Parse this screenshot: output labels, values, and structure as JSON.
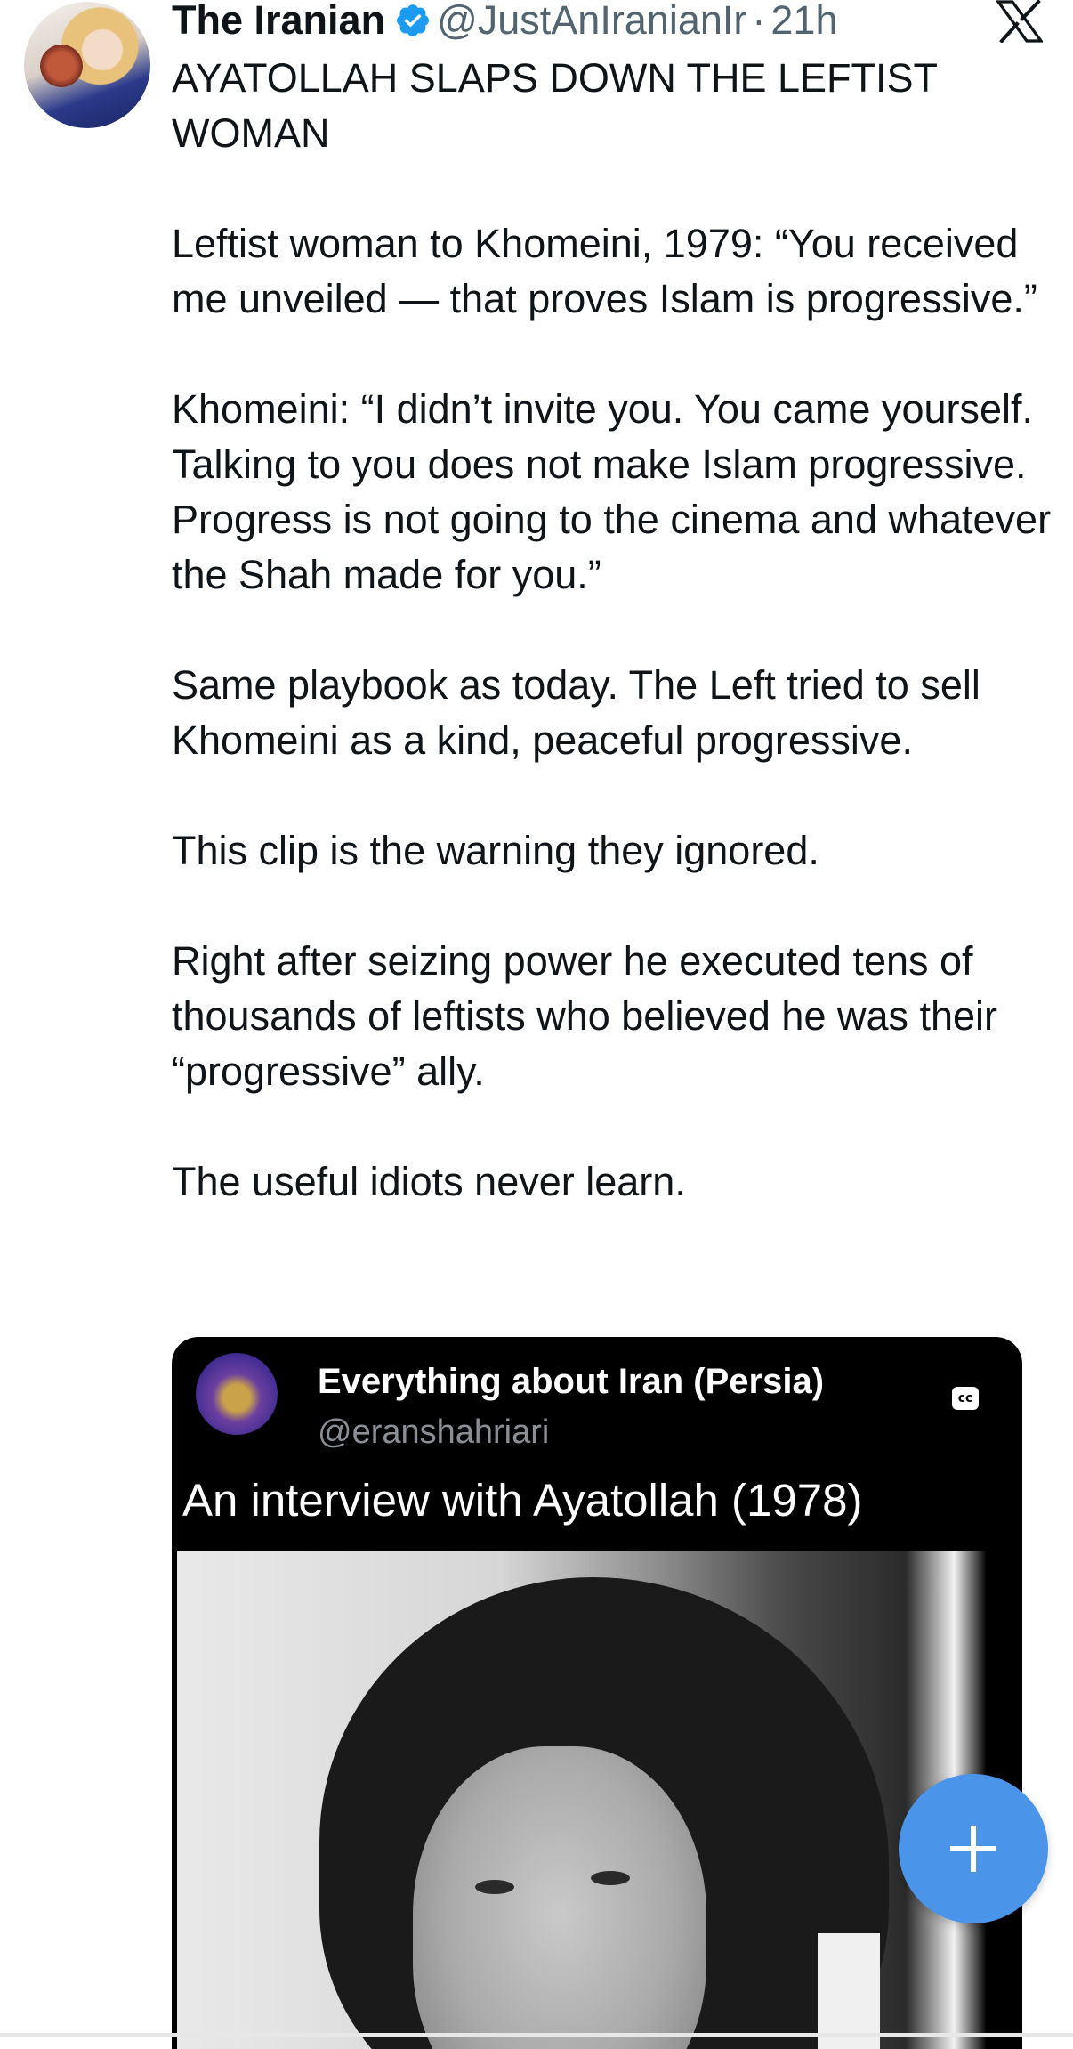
{
  "author": {
    "display_name": "The Iranian",
    "handle": "@JustAnIranianIr",
    "separator": "·",
    "time_ago": "21h",
    "verified": true,
    "verified_color": "#1d9bf0"
  },
  "tweet": {
    "paragraphs": [
      "AYATOLLAH SLAPS DOWN THE LEFTIST WOMAN",
      "Leftist woman to Khomeini, 1979: “You received me unveiled — that proves Islam is progressive.”",
      "Khomeini: “I didn’t invite you. You came yourself. Talking to you does not make Islam progressive. Progress is not going to the cinema and whatever the Shah made for you.”",
      "Same playbook as today. The Left tried to sell Khomeini as a kind, peaceful progressive.",
      "This clip is the warning they ignored.",
      "Right after seizing power he executed tens of thousands of leftists who believed he was their “progressive” ally.",
      "The useful idiots never learn."
    ]
  },
  "media": {
    "source_name": "Everything about Iran (Persia)",
    "source_handle": "@eranshahriari",
    "cc_label": "cc",
    "video_title": "An interview with Ayatollah (1978)"
  },
  "icons": {
    "close": "x-logo-icon",
    "verified": "verified-badge-icon",
    "compose": "plus-icon"
  },
  "colors": {
    "fab": "#4a95ea",
    "text": "#0f1419",
    "muted": "#536471"
  }
}
